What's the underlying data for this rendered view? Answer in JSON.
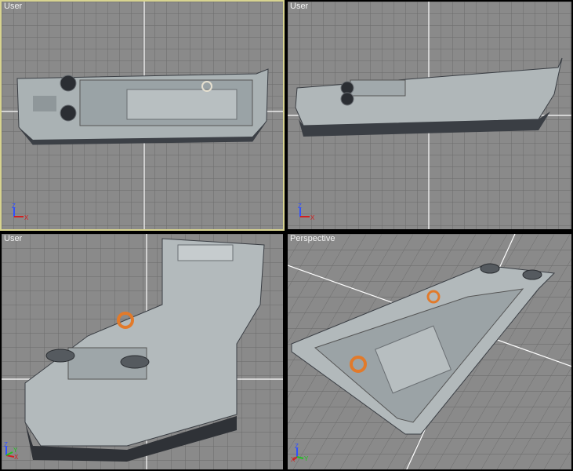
{
  "viewports": [
    {
      "label": "User",
      "active": true
    },
    {
      "label": "User",
      "active": false
    },
    {
      "label": "User",
      "active": false
    },
    {
      "label": "Perspective",
      "active": false
    }
  ],
  "axis": {
    "z": "Z",
    "x": "X",
    "y": "Y"
  },
  "colors": {
    "grid_bg": "#8a8a8a",
    "grid_line": "#6a6a6a",
    "axis_line": "#ffffff",
    "active_border": "#d8d490",
    "hull_light": "#b7bfc0",
    "hull_dark": "#3a3e44",
    "lifebuoy": "#e27a2a",
    "x_axis": "#d22020",
    "y_axis": "#20c020",
    "z_axis": "#3050ff"
  }
}
